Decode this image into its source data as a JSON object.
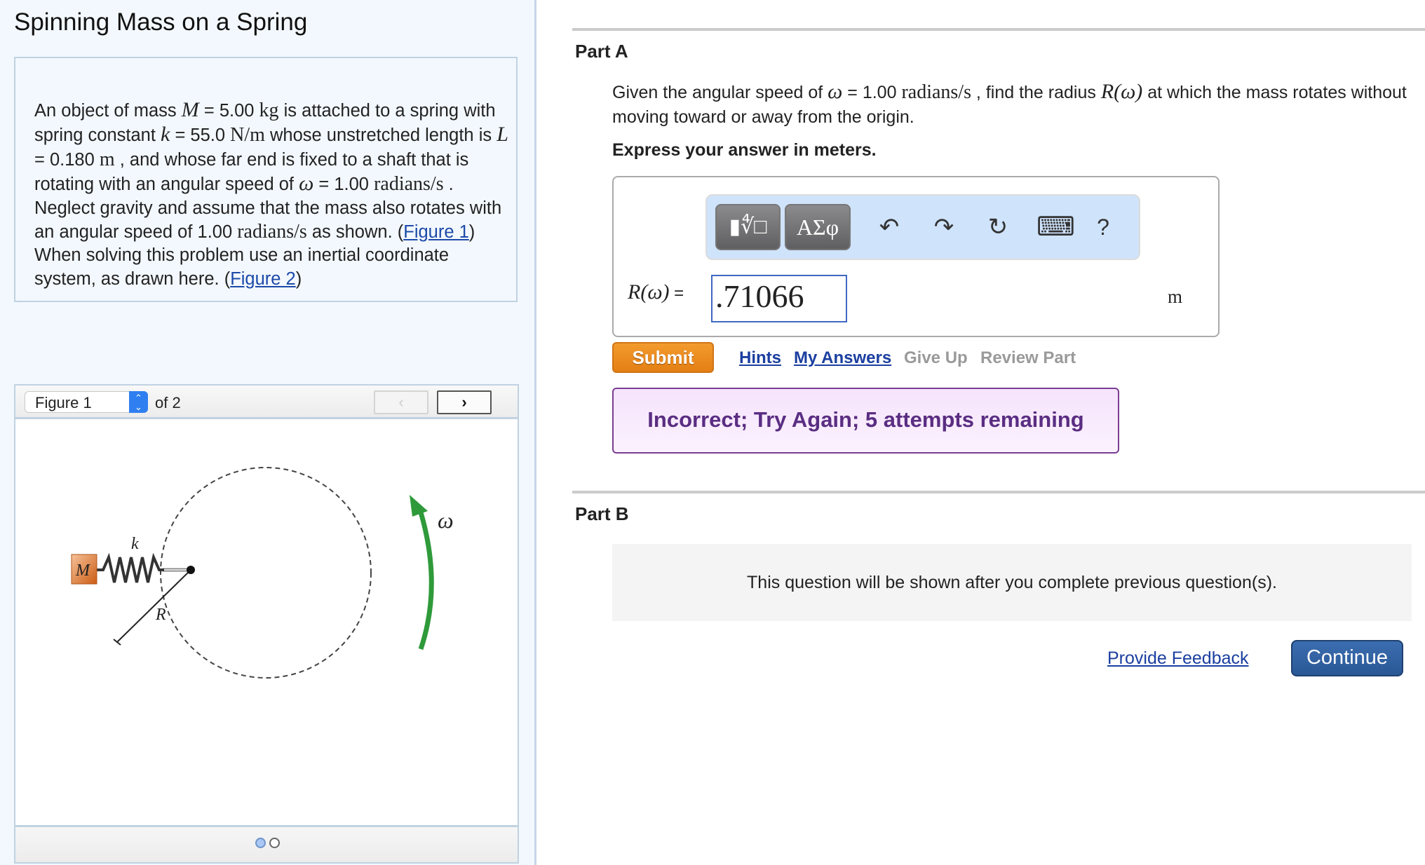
{
  "title": "Spinning Mass on a Spring",
  "problem": {
    "t1": "An object of mass ",
    "M_sym": "M",
    "t2": " = 5.00 ",
    "kg": "kg",
    "t3": " is attached to a spring with spring constant ",
    "k_sym": "k",
    "t4": " = 55.0 ",
    "Nm": "N/m",
    "t5": " whose unstretched length is ",
    "L_sym": "L",
    "t6": " = 0.180 ",
    "m_unit": "m",
    "t7": " , and whose far end is fixed to a shaft that is rotating with an angular speed of ",
    "w_sym": "ω",
    "t8": " = 1.00 ",
    "rad": "radians/s",
    "t9": " . Neglect gravity and assume that the mass also rotates with an angular speed of 1.00 ",
    "rad2": "radians/s",
    "t10": " as shown. (",
    "fig1_link": "Figure 1",
    "t11": ") When solving this problem use an inertial coordinate system, as drawn here. (",
    "fig2_link": "Figure 2",
    "t12": ")"
  },
  "figure": {
    "select_value": "Figure 1",
    "of_label": "of 2",
    "prev_label": "‹",
    "next_label": "›",
    "labels": {
      "mass": "M",
      "spring": "k",
      "radius": "R",
      "omega": "ω"
    },
    "colors": {
      "mass": "#d9742f",
      "arrow": "#2f9a3a"
    },
    "dots": {
      "count": 2,
      "active": 1
    }
  },
  "partA": {
    "label": "Part A",
    "q1": "Given the angular speed of ",
    "w": "ω",
    "q2": " = 1.00 ",
    "rad": "radians/s",
    "q3": " , find the radius ",
    "R": "R(ω)",
    "q4": " at which the mass rotates without moving toward or away from the origin.",
    "express": "Express your answer in meters.",
    "toolbar": {
      "templates": "▮∜□",
      "greek": "ΑΣφ",
      "undo": "↶",
      "redo": "↷",
      "reset": "↻",
      "keyboard": "⌨",
      "help": "?"
    },
    "answer_label": "R(ω)",
    "answer_eq": " =",
    "answer_value": ".71066",
    "unit": "m",
    "submit": "Submit",
    "links": {
      "hints": "Hints",
      "my_answers": "My Answers",
      "give_up": "Give Up",
      "review_part": "Review Part"
    },
    "feedback": "Incorrect; Try Again; 5 attempts remaining"
  },
  "partB": {
    "label": "Part B",
    "locked_message": "This question will be shown after you complete previous question(s)."
  },
  "footer": {
    "provide_feedback": "Provide Feedback",
    "continue": "Continue"
  }
}
